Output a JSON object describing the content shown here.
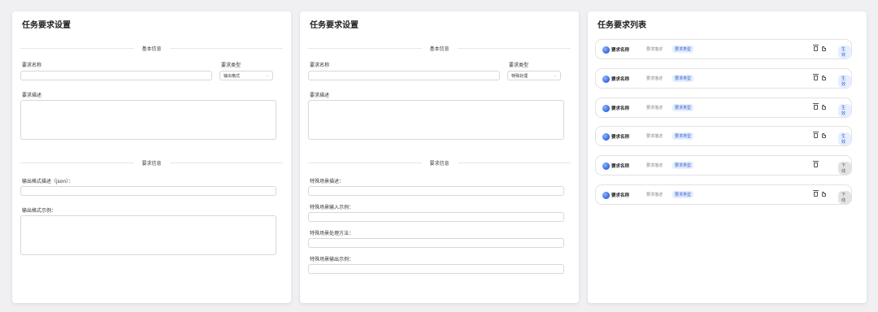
{
  "panel1": {
    "title": "任务要求设置",
    "section_basic": "基本信息",
    "name_label": "要求名称",
    "type_label": "要求类型",
    "type_value": "输出格式",
    "desc_label": "要求描述",
    "section_req": "要求信息",
    "field1_label": "输出格式描述（json）：",
    "field2_label": "输出格式示例："
  },
  "panel2": {
    "title": "任务要求设置",
    "section_basic": "基本信息",
    "name_label": "要求名称",
    "type_label": "要求类型",
    "type_value": "特殊处理",
    "desc_label": "要求描述",
    "section_req": "要求信息",
    "field1_label": "特殊场景描述：",
    "field2_label": "特殊场景输入示例：",
    "field3_label": "特殊场景处理方法：",
    "field4_label": "特殊场景输出示例："
  },
  "panel3": {
    "title": "任务要求列表",
    "items": [
      {
        "name": "要求名称",
        "desc": "要求描述",
        "tag": "要求类型",
        "status": "生效",
        "active": true
      },
      {
        "name": "要求名称",
        "desc": "要求描述",
        "tag": "要求类型",
        "status": "生效",
        "active": true
      },
      {
        "name": "要求名称",
        "desc": "要求描述",
        "tag": "要求类型",
        "status": "生效",
        "active": true
      },
      {
        "name": "要求名称",
        "desc": "要求描述",
        "tag": "要求类型",
        "status": "生效",
        "active": true
      },
      {
        "name": "要求名称",
        "desc": "要求描述",
        "tag": "要求类型",
        "status": "下线",
        "active": false
      },
      {
        "name": "要求名称",
        "desc": "要求描述",
        "tag": "要求类型",
        "status": "下线",
        "active": false
      }
    ]
  },
  "colors": {
    "accent": "#2f5fd0",
    "tag_bg": "#e6eeff",
    "offline_bg": "#e3e3e3"
  }
}
